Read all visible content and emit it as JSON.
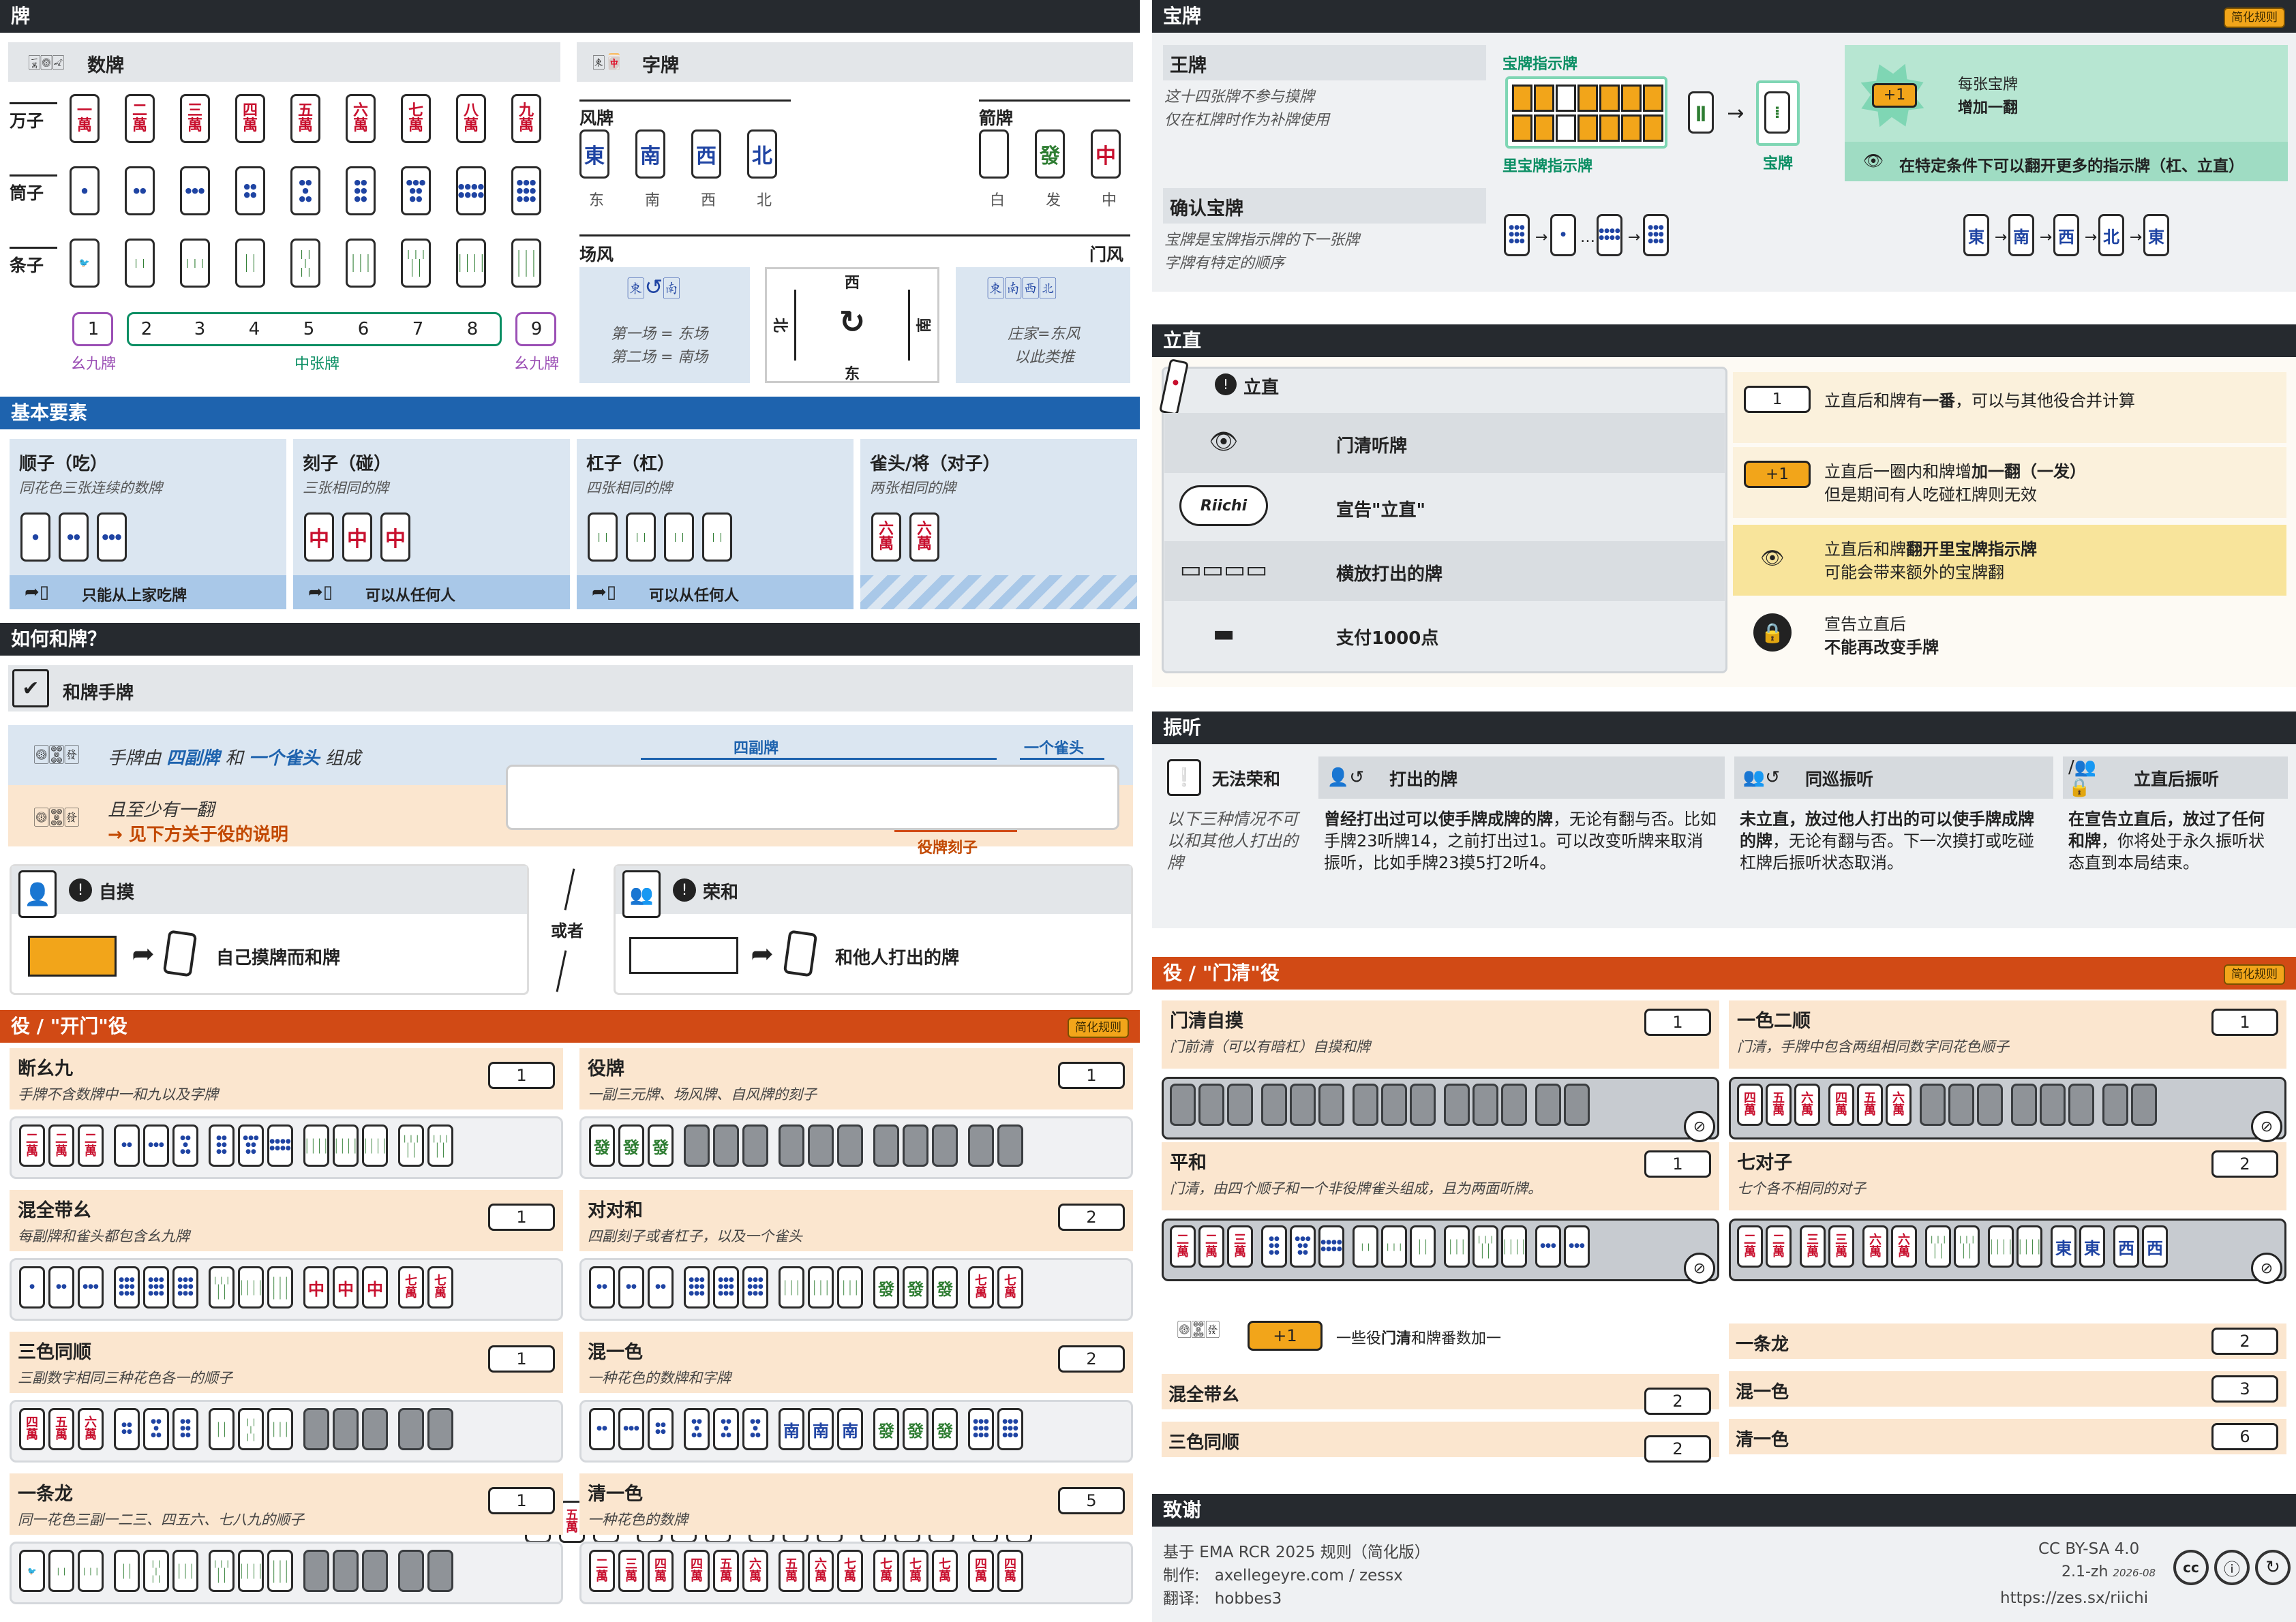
{
  "left": {
    "tiles_band": "牌",
    "suits": {
      "title": "数牌",
      "rows": [
        {
          "label": "万子",
          "kind": "man",
          "tiles": [
            "一",
            "二",
            "三",
            "四",
            "五",
            "六",
            "七",
            "八",
            "九"
          ]
        },
        {
          "label": "筒子",
          "kind": "pin",
          "tiles": [
            "1",
            "2",
            "3",
            "4",
            "5",
            "6",
            "7",
            "8",
            "9"
          ]
        },
        {
          "label": "条子",
          "kind": "sou",
          "tiles": [
            "1",
            "2",
            "3",
            "4",
            "5",
            "6",
            "7",
            "8",
            "9"
          ]
        }
      ],
      "numbers": [
        "1",
        "2",
        "3",
        "4",
        "5",
        "6",
        "7",
        "8",
        "9"
      ],
      "terminal_left": "幺九牌",
      "simples": "中张牌",
      "terminal_right": "幺九牌"
    },
    "honors": {
      "title": "字牌",
      "winds_title": "风牌",
      "winds": [
        {
          "glyph": "東",
          "label": "东"
        },
        {
          "glyph": "南",
          "label": "南"
        },
        {
          "glyph": "西",
          "label": "西"
        },
        {
          "glyph": "北",
          "label": "北"
        }
      ],
      "dragons_title": "箭牌",
      "dragons": [
        {
          "glyph": "",
          "label": "白"
        },
        {
          "glyph": "發",
          "label": "发"
        },
        {
          "glyph": "中",
          "label": "中"
        }
      ],
      "round_wind_title": "场风",
      "seat_wind_title": "门风",
      "round_line1": "第一场 = 东场",
      "round_line2": "第二场 = 南场",
      "table_top": "西",
      "table_left": "北",
      "table_right": "南",
      "table_bottom": "东",
      "seat_line1": "庄家=东风",
      "seat_line2": "以此类推"
    },
    "basics_band": "基本要素",
    "melds": [
      {
        "title": "顺子（吃）",
        "desc": "同花色三张连续的数牌",
        "note": "只能从上家吃牌"
      },
      {
        "title": "刻子（碰）",
        "desc": "三张相同的牌",
        "note": "可以从任何人"
      },
      {
        "title": "杠子（杠）",
        "desc": "四张相同的牌",
        "note": "可以从任何人"
      },
      {
        "title": "雀头/将（对子）",
        "desc": "两张相同的牌",
        "note": ""
      }
    ],
    "how_band": "如何和牌？",
    "winning_hand_title": "和牌手牌",
    "hand_line1_pre": "手牌由",
    "hand_line1_a": "四副牌",
    "hand_line1_mid": "和",
    "hand_line1_b": "一个雀头",
    "hand_line1_post": "组成",
    "hand_line2": "且至少有一翻",
    "hand_line3": "→ 见下方关于役的说明",
    "label_four_melds": "四副牌",
    "label_pair": "一个雀头",
    "label_yakuhai_set": "役牌刻子",
    "tsumo_title": "自摸",
    "tsumo_desc": "自己摸牌而和牌",
    "or": "或者",
    "ron_title": "荣和",
    "ron_desc": "和他人打出的牌",
    "open_band": "役 / \"开门\"役",
    "open_chip": "简化规则",
    "open_yaku": [
      {
        "name": "断幺九",
        "desc": "手牌不含数牌中一和九以及字牌",
        "han": "1"
      },
      {
        "name": "役牌",
        "desc": "一副三元牌、场风牌、自风牌的刻子",
        "han": "1"
      },
      {
        "name": "混全带幺",
        "desc": "每副牌和雀头都包含幺九牌",
        "han": "1"
      },
      {
        "name": "对对和",
        "desc": "四副刻子或者杠子，以及一个雀头",
        "han": "2"
      },
      {
        "name": "三色同顺",
        "desc": "三副数字相同三种花色各一的顺子",
        "han": "1"
      },
      {
        "name": "混一色",
        "desc": "一种花色的数牌和字牌",
        "han": "2"
      },
      {
        "name": "一条龙",
        "desc": "同一花色三副一二三、四五六、七八九的顺子",
        "han": "1"
      },
      {
        "name": "清一色",
        "desc": "一种花色的数牌",
        "han": "5"
      }
    ]
  },
  "right": {
    "dora_band": "宝牌",
    "dora_chip": "简化规则",
    "dead_wall_title": "王牌",
    "dead_wall_line1": "这十四张牌不参与摸牌",
    "dead_wall_line2": "仅在杠牌时作为补牌使用",
    "indicator_label": "宝牌指示牌",
    "ura_indicator_label": "里宝牌指示牌",
    "dora_label": "宝牌",
    "dora_bonus_tag": "+1",
    "dora_bonus_line1": "每张宝牌",
    "dora_bonus_line2": "增加一翻",
    "dora_more": "在特定条件下可以翻开更多的指示牌（杠、立直）",
    "confirm_title": "确认宝牌",
    "confirm_line1": "宝牌是宝牌指示牌的下一张牌",
    "confirm_line2": "字牌有特定的顺序",
    "riichi_band": "立直",
    "riichi_title": "立直",
    "riichi_steps": [
      "门清听牌",
      "宣告\"立直\"",
      "横放打出的牌",
      "支付1000点"
    ],
    "riichi_speech": "Riichi",
    "riichi_benefits": [
      {
        "tag": "1",
        "text_pre": "立直后和牌有",
        "text_bold": "一番",
        "text_post": "，可以与其他役合并计算",
        "line2": ""
      },
      {
        "tag": "+1",
        "text_pre": "立直后一圈内和牌增",
        "text_bold": "加一翻（一发）",
        "text_post": "",
        "line2": "但是期间有人吃碰杠牌则无效"
      },
      {
        "tag": "",
        "text_pre": "立直后和牌",
        "text_bold": "翻开里宝牌指示牌",
        "text_post": "",
        "line2": "可能会带来额外的宝牌翻"
      },
      {
        "tag": "",
        "text_pre": "宣告立直后",
        "text_bold": "",
        "text_post": "",
        "line2": "不能再改变手牌"
      }
    ],
    "furiten_band": "振听",
    "furiten_cols": [
      {
        "title": "无法荣和",
        "body": "以下三种情况不可以和其他人打出的牌"
      },
      {
        "title": "打出的牌",
        "body_bold": "曾经打出过可以使手牌成牌的牌",
        "body": "，无论有翻与否。比如手牌23听牌14，之前打出过1。可以改变听牌来取消振听，比如手牌23摸5打2听4。"
      },
      {
        "title": "同巡振听",
        "body_bold": "未立直，放过他人打出的可以使手牌成牌的牌",
        "body": "，无论有翻与否。下一次摸打或吃碰杠牌后振听状态取消。"
      },
      {
        "title": "立直后振听",
        "body_bold": "在宣告立直后，放过了任何和牌",
        "body": "，你将处于永久振听状态直到本局结束。"
      }
    ],
    "closed_band": "役 / \"门清\"役",
    "closed_chip": "简化规则",
    "closed_yaku": [
      {
        "name": "门清自摸",
        "desc": "门前清（可以有暗杠）自摸和牌",
        "han": "1"
      },
      {
        "name": "一色二顺",
        "desc": "门清，手牌中包含两组相同数字同花色顺子",
        "han": "1"
      },
      {
        "name": "平和",
        "desc": "门清，由四个顺子和一个非役牌雀头组成，且为两面听牌。",
        "han": "1"
      },
      {
        "name": "七对子",
        "desc": "七个各不相同的对子",
        "han": "2"
      }
    ],
    "closed_bonus_tag": "+1",
    "closed_bonus_pre": "一些役",
    "closed_bonus_bold": "门清",
    "closed_bonus_post": "和牌番数加一",
    "closed_bonus_list": [
      {
        "name": "混全带幺",
        "han": "2"
      },
      {
        "name": "三色同顺",
        "han": "2"
      },
      {
        "name": "一条龙",
        "han": "2"
      },
      {
        "name": "混一色",
        "han": "3"
      },
      {
        "name": "清一色",
        "han": "6"
      }
    ],
    "credits_band": "致谢",
    "credits_line1": "基于 EMA RCR 2025 规则（简化版）",
    "credits_line2_label": "制作:",
    "credits_line2": "axellegeyre.com / zessx",
    "credits_line3_label": "翻译:",
    "credits_line3": "hobbes3",
    "license": "CC BY-SA 4.0",
    "version": "2.1-zh",
    "date": "2026-08",
    "url": "https://zes.sx/riichi"
  },
  "colors": {
    "dark": "#262a2f",
    "blue": "#1e63ae",
    "red": "#d14a15",
    "orange_chip": "#f2a51a",
    "green": "#0a8e63",
    "purple": "#9b4fb5"
  }
}
